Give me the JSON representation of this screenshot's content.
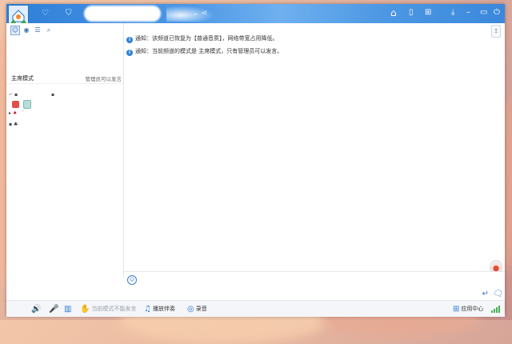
{
  "titlebar": {
    "icons": [
      "heart-icon",
      "shield-icon",
      "share-icon"
    ],
    "right_icons": [
      "home-icon",
      "notebook-icon",
      "gamepad-icon",
      "download-icon",
      "minimize-icon",
      "restore-icon",
      "power-icon"
    ]
  },
  "left_panel": {
    "tabs": [
      "user-icon",
      "location-icon",
      "list-icon",
      "search-icon"
    ],
    "mode_title": "主席模式",
    "mode_note": "管理员可以发言"
  },
  "chat": {
    "notices": [
      "通知：该频道已恢复为【普通音质】，网络带宽占用降低。",
      "通知：当前频道的模式是 主席模式，只有管理员可以发言。"
    ]
  },
  "bottombar": {
    "mic_disabled_label": "当前模式不能发言",
    "accompany_label": "播放伴奏",
    "record_label": "录音",
    "app_center_label": "应用中心"
  },
  "colors": {
    "titlebar": "#3b88dc",
    "accent": "#2a78d4",
    "notice_icon": "#2d82d6"
  }
}
